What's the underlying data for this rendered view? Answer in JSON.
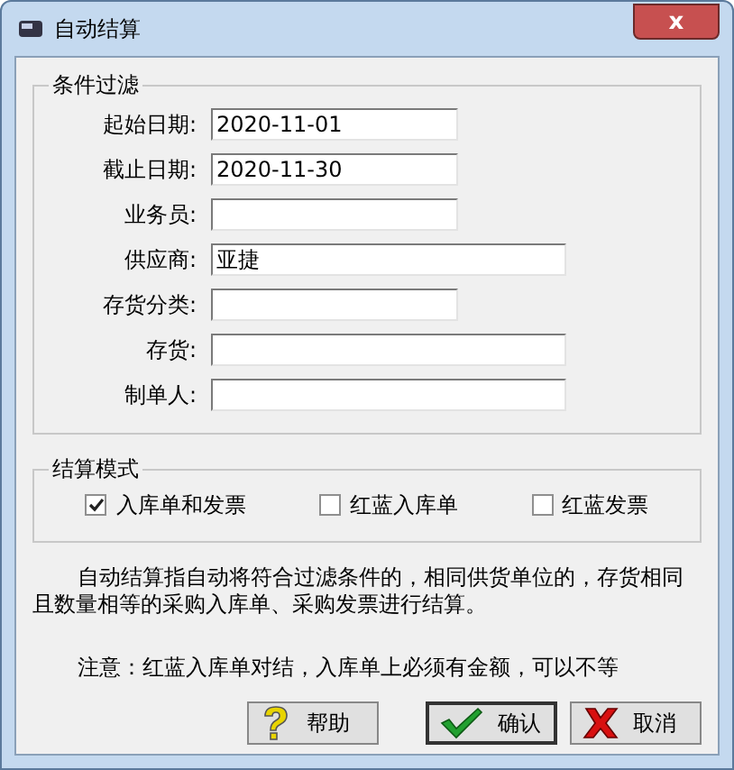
{
  "window": {
    "title": "自动结算",
    "close": "x"
  },
  "filter": {
    "title": "条件过滤",
    "fields": [
      {
        "label": "起始日期:",
        "value": "2020-11-01",
        "kind": "short"
      },
      {
        "label": "截止日期:",
        "value": "2020-11-30",
        "kind": "short"
      },
      {
        "label": "业务员:",
        "kind": "short"
      },
      {
        "label": "供应商:",
        "value": "亚捷",
        "kind": "long"
      },
      {
        "label": "存货分类:",
        "kind": "short"
      },
      {
        "label": "存货:",
        "kind": "long"
      },
      {
        "label": "制单人:",
        "kind": "long"
      }
    ]
  },
  "mode": {
    "title": "结算模式",
    "options": [
      {
        "label": "入库单和发票",
        "checked": true
      },
      {
        "label": "红蓝入库单",
        "checked": false
      },
      {
        "label": "红蓝发票",
        "checked": false
      }
    ]
  },
  "description": "自动结算指自动将符合过滤条件的，相同供货单位的，存货相同且数量相等的采购入库单、采购发票进行结算。",
  "note": "注意：红蓝入库单对结，入库单上必须有金额，可以不等",
  "buttons": [
    {
      "label": "帮助",
      "kind": "help",
      "default": false
    },
    {
      "label": "确认",
      "kind": "ok",
      "default": true
    },
    {
      "label": "取消",
      "kind": "cancel",
      "default": false
    }
  ]
}
